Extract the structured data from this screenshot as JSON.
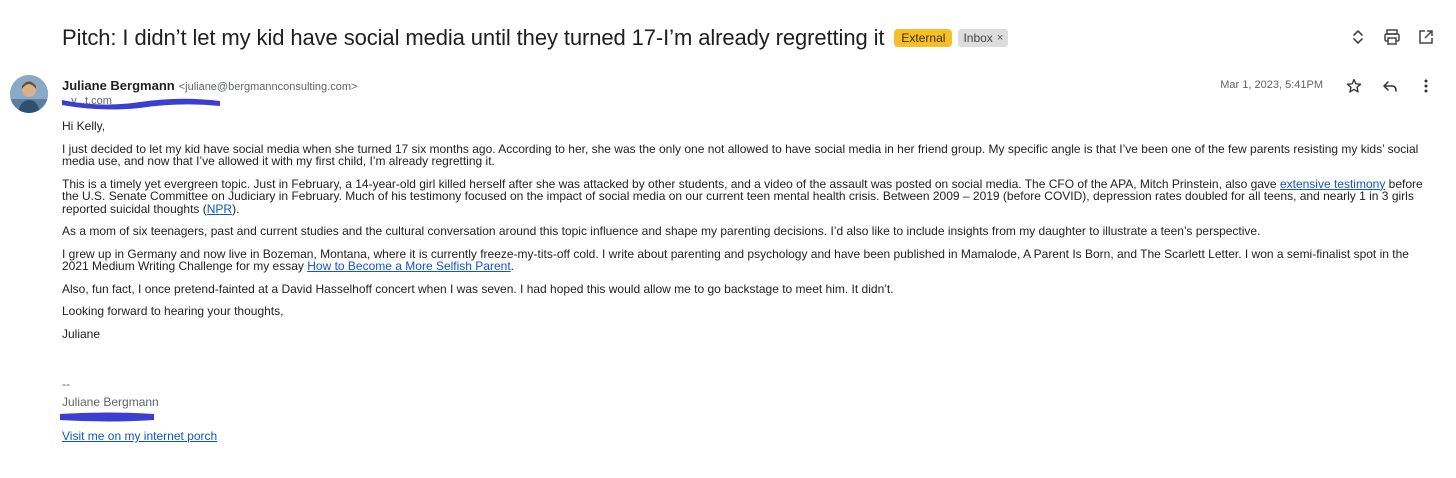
{
  "email": {
    "subject": "Pitch: I didn’t let my kid have social media until they turned 17-I’m already regretting it",
    "labels": {
      "external": "External",
      "inbox": "Inbox",
      "inbox_remove": "×"
    },
    "sender": {
      "name": "Juliane Bergmann",
      "email": "<juliane@bergmannconsulting.com>"
    },
    "recipient_visible_fragment": "...y...t.com",
    "date": "Mar 1, 2023, 5:41PM",
    "body": {
      "greeting": "Hi Kelly,",
      "p1": "I just decided to let my kid have social media when she turned 17 six months ago. According to her, she was the only one not allowed to have social media in her friend group. My specific angle is that I’ve been one of the few parents resisting my kids’ social media use, and now that I’ve allowed it with my first child, I’m already regretting it.",
      "p2_a": "This is a timely yet evergreen topic. Just in February, a 14-year-old girl killed herself after she was attacked by other students, and a video of the assault was posted on social media. The CFO of the APA, Mitch Prinstein, also gave ",
      "p2_link": "extensive testimony",
      "p2_b": " before the U.S. Senate Committee on Judiciary in February. Much of his testimony focused on the impact of social media on our current teen mental health crisis. Between 2009 – 2019 (before COVID), depression rates doubled for all teens, and nearly 1 in 3 girls reported suicidal thoughts (",
      "p2_link2": "NPR",
      "p2_c": ").",
      "p3": "As a mom of six teenagers, past and current studies and the cultural conversation around this topic influence and shape my parenting decisions. I’d also like to include insights from my daughter to illustrate a teen’s perspective.",
      "p4_a": "I grew up in Germany and now live in Bozeman, Montana, where it is currently freeze-my-tits-off cold. I write about parenting and psychology and have been published in Mamalode, A Parent Is Born, and The Scarlett Letter. I won a semi-finalist spot in the 2021 Medium Writing Challenge for my essay ",
      "p4_link": "How to Become a More Selfish Parent",
      "p4_b": ".",
      "p5": "Also, fun fact, I once pretend-fainted at a David Hasselhoff concert when I was seven. I had hoped this would allow me to go backstage to meet him. It didn’t.",
      "p6": "Looking forward to hearing your thoughts,",
      "sign_off": "Juliane"
    },
    "signature": {
      "dashes": "--",
      "name": "Juliane Bergmann",
      "link": "Visit me on my internet porch"
    }
  },
  "icons": [
    "expand-collapse-icon",
    "print-icon",
    "open-in-new-window-icon",
    "star-icon",
    "reply-icon",
    "more-options-icon"
  ],
  "colors": {
    "external_chip": "#f6bf26",
    "inbox_chip": "#dddddd",
    "link": "#1155cc",
    "redaction": "#3a3fcf"
  }
}
